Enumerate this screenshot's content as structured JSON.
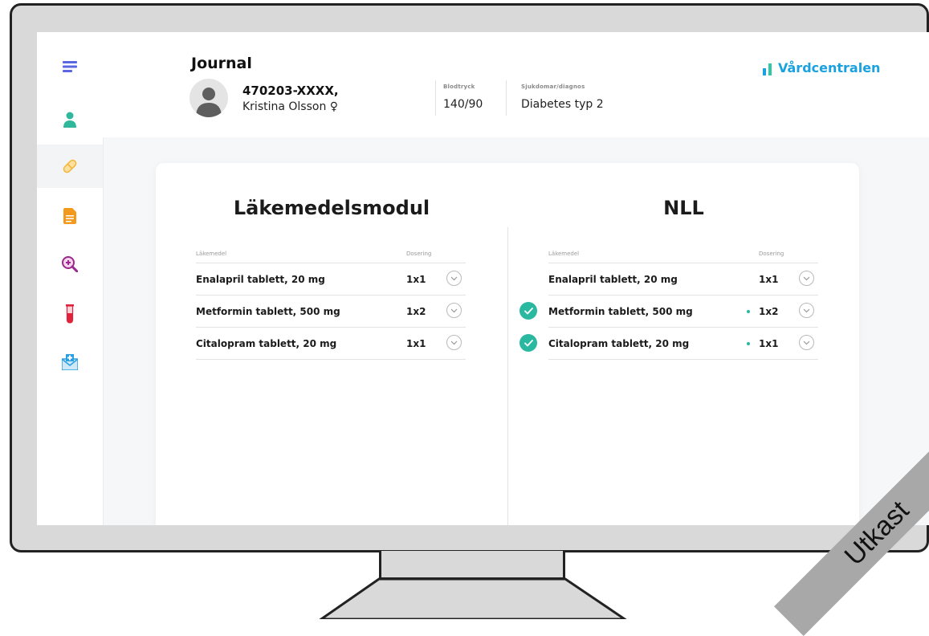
{
  "header": {
    "title": "Journal",
    "patient": {
      "id": "470203-XXXX,",
      "name": "Kristina Olsson ♀"
    },
    "blood_pressure": {
      "label": "Blodtryck",
      "value": "140/90"
    },
    "diagnosis": {
      "label": "Sjukdomar/diagnos",
      "value": "Diabetes typ 2"
    },
    "brand": "Vårdcentralen"
  },
  "sidebar": {
    "items": [
      {
        "icon": "menu-icon",
        "color": "#5b67e0"
      },
      {
        "icon": "person-icon",
        "color": "#2fb89b"
      },
      {
        "icon": "pill-icon",
        "color": "#f5b53a",
        "active": true
      },
      {
        "icon": "document-icon",
        "color": "#f39a1e"
      },
      {
        "icon": "magnifier-icon",
        "color": "#9c2a8c"
      },
      {
        "icon": "test-tube-icon",
        "color": "#e0233c"
      },
      {
        "icon": "mail-icon",
        "color": "#2a9fe0"
      }
    ]
  },
  "left_panel": {
    "title": "Läkemedelsmodul",
    "col_drug": "Läkemedel",
    "col_dose": "Dosering",
    "rows": [
      {
        "drug": "Enalapril tablett, 20 mg",
        "dose": "1x1"
      },
      {
        "drug": "Metformin tablett, 500 mg",
        "dose": "1x2"
      },
      {
        "drug": "Citalopram tablett, 20 mg",
        "dose": "1x1"
      }
    ]
  },
  "right_panel": {
    "title": "NLL",
    "col_drug": "Läkemedel",
    "col_dose": "Dosering",
    "rows": [
      {
        "drug": "Enalapril tablett, 20 mg",
        "dose": "1x1",
        "checked": false
      },
      {
        "drug": "Metformin tablett, 500 mg",
        "dose": "1x2",
        "checked": true
      },
      {
        "drug": "Citalopram tablett, 20 mg",
        "dose": "1x1",
        "checked": true
      }
    ]
  },
  "banner": "Utkast",
  "colors": {
    "accent_blue": "#1aa1e0",
    "check_green": "#2ab8a0",
    "monitor_gray": "#d9d9d9"
  }
}
